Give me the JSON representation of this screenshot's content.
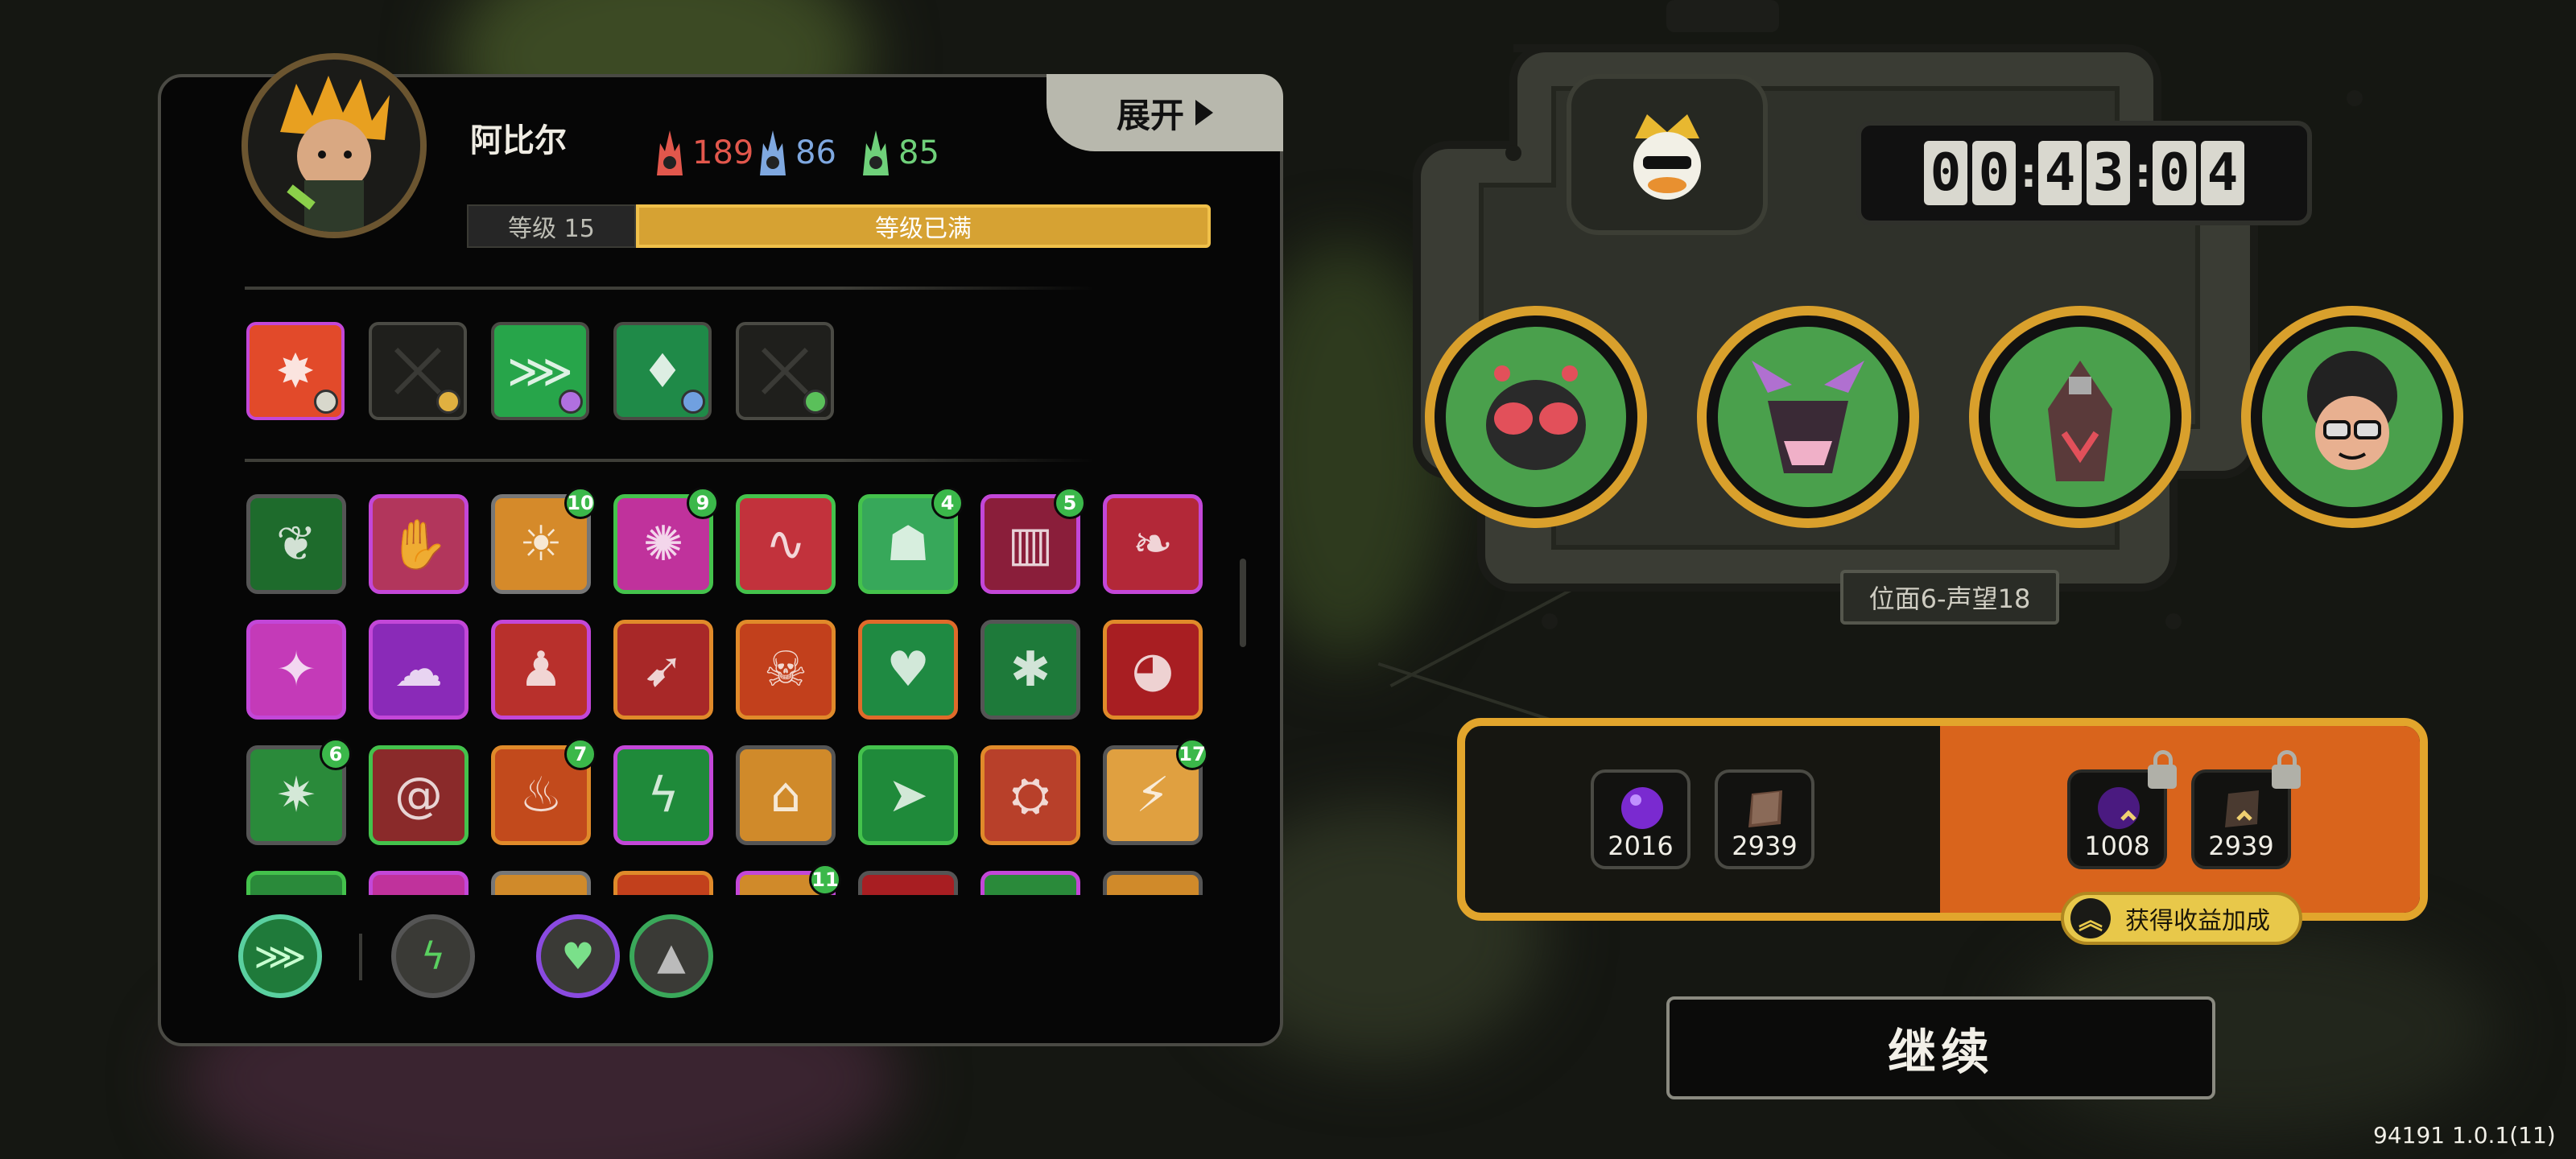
{
  "hero": {
    "name": "阿比尔",
    "stats": [
      {
        "icon": "red-soul-icon",
        "value": "189",
        "color": "#e2574c"
      },
      {
        "icon": "blue-soul-icon",
        "value": "86",
        "color": "#7fa8e0"
      },
      {
        "icon": "green-soul-icon",
        "value": "85",
        "color": "#6fd07a"
      }
    ],
    "level_label": "等级 15",
    "level_status": "等级已满",
    "level_progress": 1.0
  },
  "panel": {
    "expand_label": "展开"
  },
  "equip_slots": [
    {
      "name": "slot-explosion",
      "icon": "explosion-icon",
      "color": "#e24a2a",
      "border": "#c347d8",
      "empty": false
    },
    {
      "name": "slot-empty-1",
      "icon": "empty-slot-icon",
      "empty": true
    },
    {
      "name": "slot-green-claw",
      "icon": "claw-icon",
      "color": "#27a54a",
      "border": "#4a4a44",
      "empty": false
    },
    {
      "name": "slot-green-crystal",
      "icon": "crystal-icon",
      "color": "#1f8a48",
      "border": "#4a4a44",
      "empty": false
    },
    {
      "name": "slot-empty-2",
      "icon": "empty-slot-icon",
      "empty": true
    }
  ],
  "items": [
    {
      "icon": "cloak-icon",
      "bg": "#1e6b2c",
      "border": "#555",
      "badge": ""
    },
    {
      "icon": "hand-icon",
      "bg": "#b2365c",
      "border": "#c347d8",
      "badge": ""
    },
    {
      "icon": "sunrise-icon",
      "bg": "#d58a2a",
      "border": "#777",
      "badge": "10"
    },
    {
      "icon": "sigil-icon",
      "bg": "#c0329c",
      "border": "#44c24c",
      "badge": "9"
    },
    {
      "icon": "tentacle-icon",
      "bg": "#c2323c",
      "border": "#44c24c",
      "badge": ""
    },
    {
      "icon": "hooded-figure-icon",
      "bg": "#37a85a",
      "border": "#44c24c",
      "badge": "4"
    },
    {
      "icon": "pillar-icon",
      "bg": "#8a1e3a",
      "border": "#c347d8",
      "badge": "5"
    },
    {
      "icon": "feather-icon",
      "bg": "#b32838",
      "border": "#c347d8",
      "badge": ""
    },
    {
      "icon": "book-icon",
      "bg": "#c43ab8",
      "border": "#c347d8",
      "badge": ""
    },
    {
      "icon": "ghost-icon",
      "bg": "#8a2ab8",
      "border": "#c347d8",
      "badge": ""
    },
    {
      "icon": "figure-icon",
      "bg": "#b8302c",
      "border": "#c347d8",
      "badge": ""
    },
    {
      "icon": "spike-icon",
      "bg": "#a82828",
      "border": "#e08a2a",
      "badge": ""
    },
    {
      "icon": "demon-face-icon",
      "bg": "#c2401c",
      "border": "#e08a2a",
      "badge": ""
    },
    {
      "icon": "heart-icon",
      "bg": "#1f8a42",
      "border": "#e06a2a",
      "badge": ""
    },
    {
      "icon": "splash-icon",
      "bg": "#1e7a3a",
      "border": "#555",
      "badge": ""
    },
    {
      "icon": "maw-icon",
      "bg": "#a81e22",
      "border": "#e08a2a",
      "badge": ""
    },
    {
      "icon": "burst-icon",
      "bg": "#2a8a3a",
      "border": "#555",
      "badge": "6"
    },
    {
      "icon": "spiral-icon",
      "bg": "#8a2a2a",
      "border": "#44c24c",
      "badge": ""
    },
    {
      "icon": "flame-icon",
      "bg": "#c24a1c",
      "border": "#e08a2a",
      "badge": "7"
    },
    {
      "icon": "lightning-icon",
      "bg": "#1f8a3a",
      "border": "#c347d8",
      "badge": ""
    },
    {
      "icon": "shrine-icon",
      "bg": "#d08a2a",
      "border": "#555",
      "badge": ""
    },
    {
      "icon": "arrow-icon",
      "bg": "#1f8a3a",
      "border": "#44c24c",
      "badge": ""
    },
    {
      "icon": "shield-icon",
      "bg": "#b8402a",
      "border": "#e08a2a",
      "badge": ""
    },
    {
      "icon": "crack-icon",
      "bg": "#e0a040",
      "border": "#555",
      "badge": "17"
    },
    {
      "icon": "item-partial-1-icon",
      "bg": "#2a8a3a",
      "border": "#44c24c",
      "badge": ""
    },
    {
      "icon": "item-partial-2-icon",
      "bg": "#c0329c",
      "border": "#c347d8",
      "badge": ""
    },
    {
      "icon": "item-partial-3-icon",
      "bg": "#d08a2a",
      "border": "#777",
      "badge": ""
    },
    {
      "icon": "item-partial-4-icon",
      "bg": "#c2401c",
      "border": "#e08a2a",
      "badge": ""
    },
    {
      "icon": "item-partial-5-icon",
      "bg": "#d08a2a",
      "border": "#c347d8",
      "badge": "11"
    },
    {
      "icon": "item-partial-6-icon",
      "bg": "#a81e22",
      "border": "#555",
      "badge": ""
    },
    {
      "icon": "item-partial-7-icon",
      "bg": "#2a8a3a",
      "border": "#c347d8",
      "badge": ""
    },
    {
      "icon": "item-partial-8-icon",
      "bg": "#d08a2a",
      "border": "#555",
      "badge": ""
    }
  ],
  "bottom_buttons": [
    {
      "name": "claw-filter-button",
      "icon": "claw-icon"
    },
    {
      "name": "lightning-filter-button",
      "icon": "lightning-icon"
    },
    {
      "name": "heart-filter-button",
      "icon": "heart-icon"
    },
    {
      "name": "triangle-filter-button",
      "icon": "triangle-icon"
    }
  ],
  "timer": {
    "digits": [
      "0",
      "0",
      "4",
      "3",
      "0",
      "4"
    ]
  },
  "enemies": [
    {
      "icon": "fly-monster-icon"
    },
    {
      "icon": "horned-demon-icon"
    },
    {
      "icon": "hooded-beast-icon"
    },
    {
      "icon": "afro-glasses-icon"
    }
  ],
  "realm_label": "位面6-声望18",
  "rewards": {
    "base": [
      {
        "icon": "purple-orb-icon",
        "value": "2016"
      },
      {
        "icon": "book-icon",
        "value": "2939"
      }
    ],
    "bonus": [
      {
        "icon": "purple-orb-icon",
        "value": "1008",
        "locked": true
      },
      {
        "icon": "book-icon",
        "value": "2939",
        "locked": true
      }
    ],
    "bonus_label": "获得收益加成"
  },
  "continue_label": "继续",
  "version": "94191 1.0.1(11)"
}
